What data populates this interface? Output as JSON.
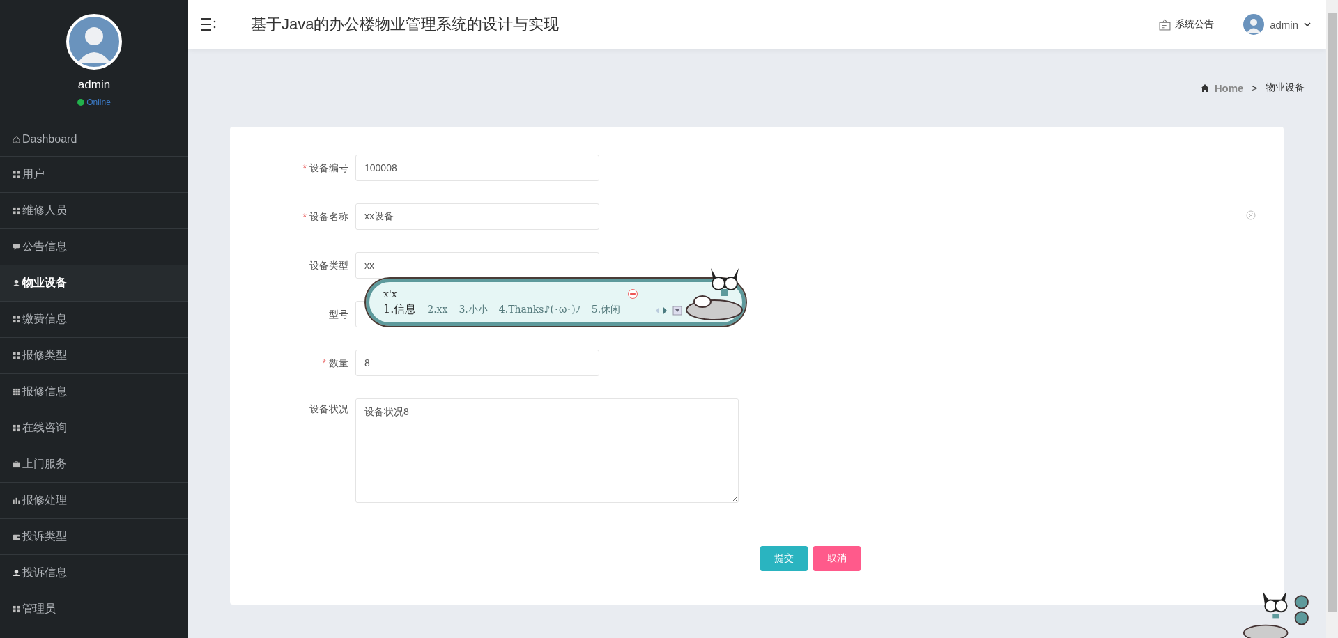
{
  "sidebar": {
    "user": {
      "name": "admin",
      "status": "Online"
    },
    "items": [
      {
        "label": "Dashboard",
        "kind": "home",
        "selected": false
      },
      {
        "label": "用户",
        "kind": "grid",
        "selected": false
      },
      {
        "label": "维修人员",
        "kind": "grid",
        "selected": false
      },
      {
        "label": "公告信息",
        "kind": "chat",
        "selected": false
      },
      {
        "label": "物业设备",
        "kind": "user",
        "selected": true
      },
      {
        "label": "缴费信息",
        "kind": "grid",
        "selected": false
      },
      {
        "label": "报修类型",
        "kind": "grid",
        "selected": false
      },
      {
        "label": "报修信息",
        "kind": "table",
        "selected": false
      },
      {
        "label": "在线咨询",
        "kind": "grid",
        "selected": false
      },
      {
        "label": "上门服务",
        "kind": "case",
        "selected": false
      },
      {
        "label": "报修处理",
        "kind": "chart",
        "selected": false
      },
      {
        "label": "投诉类型",
        "kind": "wallet",
        "selected": false
      },
      {
        "label": "投诉信息",
        "kind": "user",
        "selected": false
      },
      {
        "label": "管理员",
        "kind": "grid",
        "selected": false
      }
    ]
  },
  "header": {
    "title": "基于Java的办公楼物业管理系统的设计与实现",
    "notice": "系统公告",
    "user": "admin"
  },
  "breadcrumb": {
    "home": "Home",
    "separator": ">",
    "current": "物业设备"
  },
  "form": {
    "required_mark": "*",
    "fields": [
      {
        "label": "设备编号",
        "required": true,
        "kind": "input",
        "value": "100008"
      },
      {
        "label": "设备名称",
        "required": true,
        "kind": "input",
        "value": "xx设备"
      },
      {
        "label": "设备类型",
        "required": false,
        "kind": "input",
        "value": "xx"
      },
      {
        "label": "型号",
        "required": false,
        "kind": "input"
      },
      {
        "label": "数量",
        "required": true,
        "kind": "input",
        "value": "8"
      },
      {
        "label": "设备状况",
        "required": false,
        "kind": "textarea",
        "value": "设备状况8"
      }
    ],
    "buttons": [
      {
        "label": "提交",
        "kind": "primary"
      },
      {
        "label": "取消",
        "kind": "danger"
      }
    ]
  },
  "ime": {
    "composition": "x'x",
    "candidates": [
      {
        "label": "1.信息",
        "selected": true
      },
      {
        "label": "2.xx",
        "selected": false
      },
      {
        "label": "3.小小",
        "selected": false
      },
      {
        "label": "4.Thanks♪(･ω･)ﾉ",
        "selected": false
      },
      {
        "label": "5.休闲",
        "selected": false
      }
    ]
  }
}
